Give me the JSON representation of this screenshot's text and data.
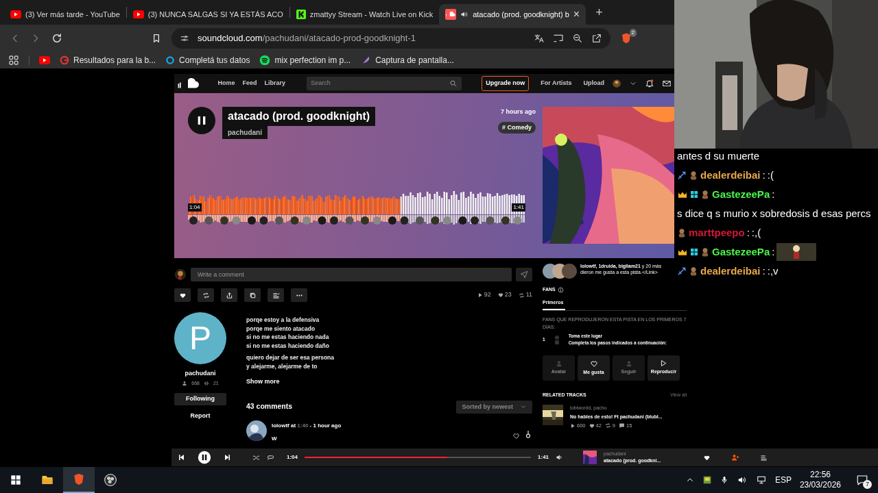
{
  "browser": {
    "tabs": [
      {
        "kind": "youtube",
        "title": "(3) Ver más tarde - YouTube",
        "selected": false,
        "audio": false
      },
      {
        "kind": "youtube",
        "title": "(3) NUNCA SALGAS SI YA ESTÁS ACO",
        "selected": false,
        "audio": false
      },
      {
        "kind": "kick",
        "title": "zmattyy Stream - Watch Live on Kick",
        "selected": false,
        "audio": false
      },
      {
        "kind": "soundcloud",
        "title": "atacado (prod. goodknight) b",
        "selected": true,
        "audio": true
      }
    ],
    "new_tab": "+",
    "close": "×",
    "url_host": "soundcloud.com",
    "url_path": "/pachudani/atacado-prod-goodknight-1",
    "extension_badge": "2",
    "bookmarks": [
      {
        "kind": "youtube"
      },
      {
        "kind": "google",
        "label": "Resultados para la b..."
      },
      {
        "kind": "ring",
        "label": "Completá tus datos"
      },
      {
        "kind": "spotify",
        "label": "mix perfection im p..."
      },
      {
        "kind": "feather",
        "label": "Captura de pantalla..."
      }
    ]
  },
  "soundcloud": {
    "nav": [
      "Home",
      "Feed",
      "Library"
    ],
    "search_placeholder": "Search",
    "upgrade": "Upgrade now",
    "links": [
      "For Artists",
      "Upload"
    ],
    "track": {
      "title": "atacado (prod. goodknight)",
      "artist": "pachudani",
      "time_ago": "7 hours ago",
      "tag": "# Comedy",
      "playing": true,
      "level": 0.63,
      "elapsed": "1:04",
      "duration": "1:41"
    },
    "comment_placeholder": "Write a comment",
    "stats": [
      {
        "kind": "plays",
        "value": "92"
      },
      {
        "kind": "likes",
        "value": "23"
      },
      {
        "kind": "reposts",
        "value": "11"
      }
    ],
    "artist": {
      "initial": "P",
      "name": "pachudani",
      "followers": "668",
      "tracks": "21",
      "follow": "Following",
      "report": "Report"
    },
    "description": [
      [
        "porqe estoy a la defensiva",
        "porqe me siento atacado",
        "si no me estas haciendo nada",
        "si no me estas haciendo daño"
      ],
      [
        "quiero dejar de ser esa persona",
        "y alejarme, alejarme de to"
      ]
    ],
    "show_more": "Show more",
    "comments_count": "43 comments",
    "sort": "Sorted by newest",
    "comment": {
      "user": "lolowtf",
      "at": "at",
      "time": "1:40",
      "ago": "- 1 hour ago",
      "text": "W"
    },
    "likers": "lolowtf, 1druida, bigliam21",
    "likers_more": "y 20 más",
    "likers_tail": "dieron me gusta a esta pista.</Link>",
    "fans": {
      "title": "FANS",
      "tabs": [
        {
          "label": "Primeros",
          "selected": true
        }
      ],
      "note": "FANS QUE REPRODUJERON ESTA PISTA EN LOS PRIMEROS 7 DÍAS:",
      "rank": "1",
      "headline": "Toma este lugar",
      "hint": "Completa los pasos indicados a continuación:",
      "actions": [
        {
          "kind": "avatar",
          "label": "Avatar",
          "disabled": true
        },
        {
          "kind": "like",
          "label": "Me gusta",
          "disabled": false
        },
        {
          "kind": "follow",
          "label": "Seguir",
          "disabled": true
        },
        {
          "kind": "play",
          "label": "Reproducir",
          "disabled": false
        }
      ]
    },
    "related": {
      "title": "RELATED TRACKS",
      "view_all": "View all",
      "tracks": [
        {
          "artist": "tobiwordd, pachu",
          "title": "No hables de esto! Ft pachudani (blubl...",
          "stats": [
            {
              "kind": "plays",
              "value": "600"
            },
            {
              "kind": "likes",
              "value": "42"
            },
            {
              "kind": "reposts",
              "value": "9"
            },
            {
              "kind": "comments",
              "value": "15"
            }
          ]
        }
      ]
    },
    "player": {
      "playing": true,
      "elapsed": "1:04",
      "duration": "1:41",
      "level": 0.63,
      "artist": "pachudani",
      "title": "atacado (prod. goodkni..."
    }
  },
  "chat": [
    {
      "kind": "continuation",
      "text": "antes d su muerte"
    },
    {
      "kind": "message",
      "user": "dealerdeibai",
      "color": "#e8a84a",
      "badges": [
        {
          "kind": "sword"
        },
        {
          "kind": "avatar"
        }
      ],
      "separator": ":",
      "text": ":("
    },
    {
      "kind": "message",
      "user": "GastezeePa",
      "color": "#4cf54c",
      "badges": [
        {
          "kind": "crown"
        },
        {
          "kind": "grid"
        },
        {
          "kind": "avatar"
        }
      ],
      "separator": ":",
      "text": "s dice q s murio x sobredosis d esas percs"
    },
    {
      "kind": "message",
      "user": "marttpeepo",
      "color": "#d4183a",
      "badges": [
        {
          "kind": "avatar"
        }
      ],
      "separator": ":",
      "text": ":,("
    },
    {
      "kind": "emote",
      "user": "GastezeePa",
      "color": "#4cf54c",
      "badges": [
        {
          "kind": "crown"
        },
        {
          "kind": "grid"
        },
        {
          "kind": "avatar"
        }
      ],
      "separator": ":"
    },
    {
      "kind": "message",
      "user": "dealerdeibai",
      "color": "#e8a84a",
      "badges": [
        {
          "kind": "sword"
        },
        {
          "kind": "avatar"
        }
      ],
      "separator": ":",
      "text": ":,v"
    }
  ],
  "taskbar": {
    "language": "ESP",
    "time": "22:56",
    "date": "23/03/2026",
    "notifications": "7"
  }
}
